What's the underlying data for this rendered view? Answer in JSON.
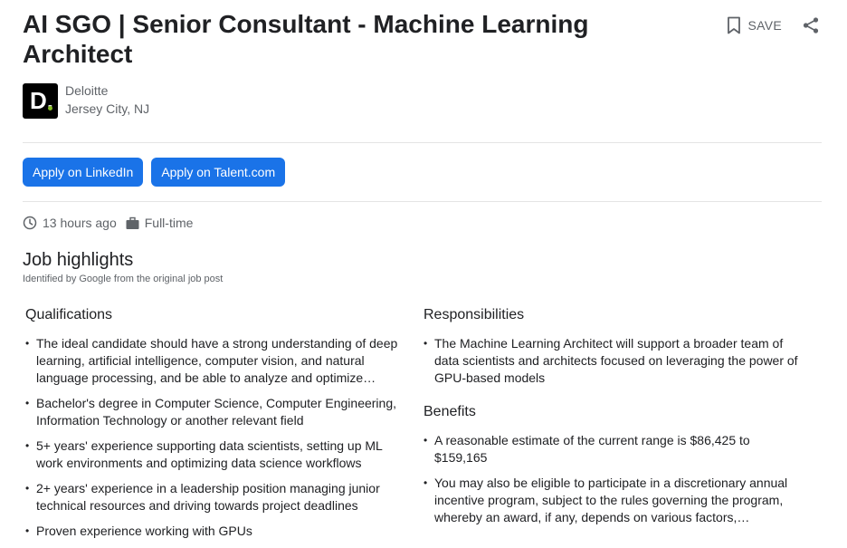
{
  "job": {
    "title": "AI SGO | Senior Consultant - Machine Learning Architect",
    "company": "Deloitte",
    "location": "Jersey City, NJ",
    "logo_letter": "D."
  },
  "actions": {
    "save_label": "SAVE",
    "save_icon": "bookmark-icon",
    "share_icon": "share-icon"
  },
  "apply_buttons": [
    {
      "label": "Apply on LinkedIn"
    },
    {
      "label": "Apply on Talent.com"
    }
  ],
  "meta": {
    "posted": "13 hours ago",
    "type": "Full-time"
  },
  "highlights": {
    "title": "Job highlights",
    "subtitle": "Identified by Google from the original job post",
    "qualifications": {
      "heading": "Qualifications",
      "items": [
        "The ideal candidate should have a strong understanding of deep learning, artificial intelligence, computer vision, and natural language processing, and be able to analyze and optimize deep…",
        "Bachelor's degree in Computer Science, Computer Engineering, Information Technology or another relevant field",
        "5+ years' experience supporting data scientists, setting up ML work environments and optimizing data science workflows",
        "2+ years' experience in a leadership position managing junior technical resources and driving towards project deadlines",
        "Proven experience working with GPUs"
      ]
    },
    "responsibilities": {
      "heading": "Responsibilities",
      "items": [
        "The Machine Learning Architect will support a broader team of data scientists and architects focused on leveraging the power of GPU-based models"
      ]
    },
    "benefits": {
      "heading": "Benefits",
      "items": [
        "A reasonable estimate of the current range is $86,425 to $159,165",
        "You may also be eligible to participate in a discretionary annual incentive program, subject to the rules governing the program, whereby an award, if any, depends on various factors, including,…"
      ]
    }
  },
  "colors": {
    "primary_button": "#1a73e8",
    "logo_background": "#000000",
    "logo_dot": "#86bc25"
  }
}
